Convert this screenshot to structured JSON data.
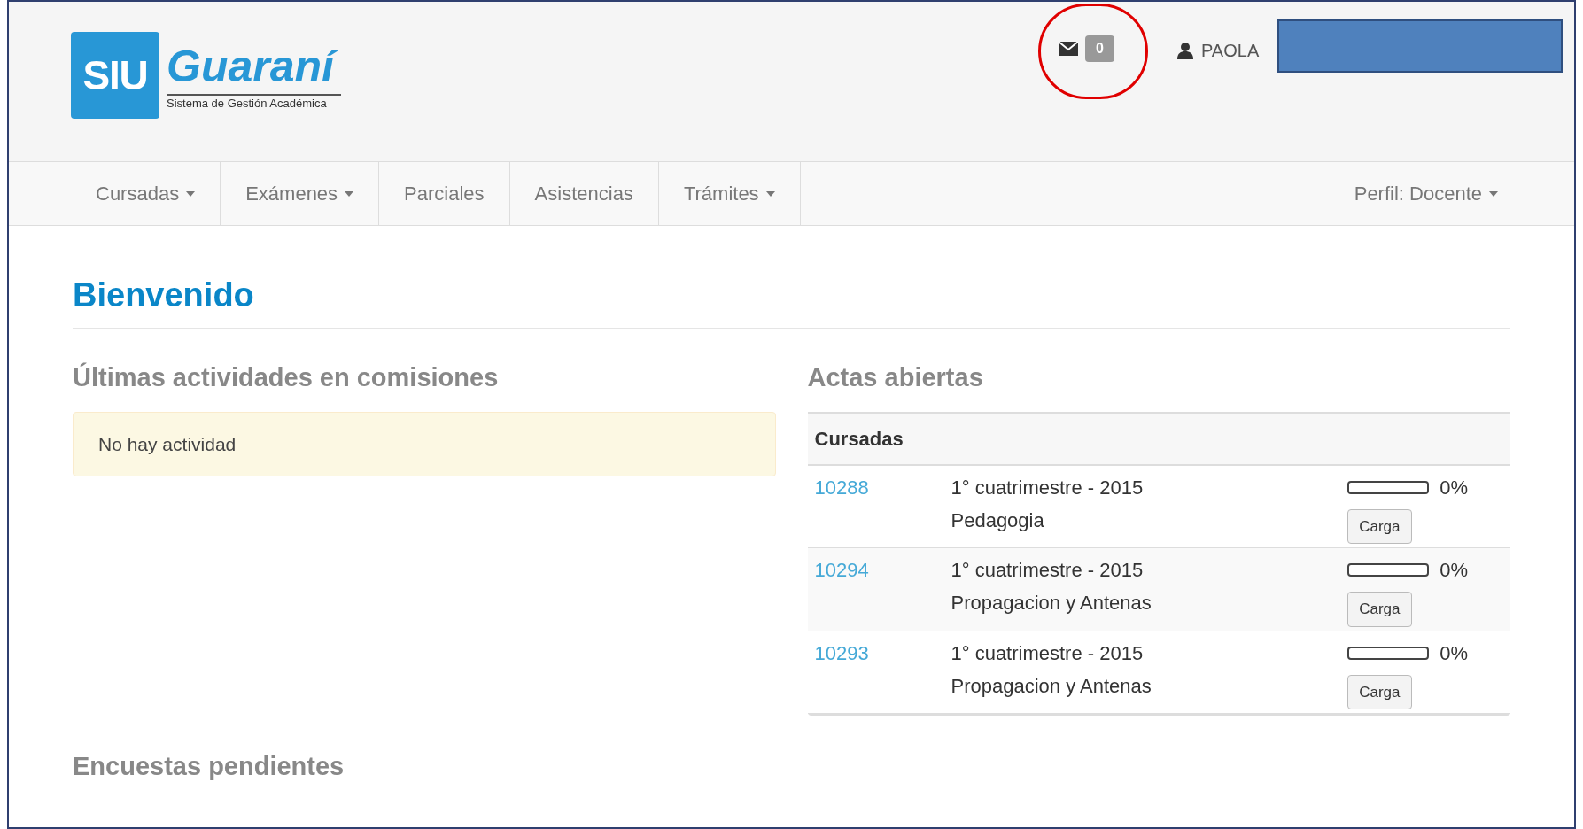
{
  "header": {
    "logo": {
      "mark": "SIU",
      "name": "Guaraní",
      "subtitle": "Sistema de Gestión Académica"
    },
    "messages": {
      "count": "0"
    },
    "user": {
      "name": "PAOLA"
    }
  },
  "nav": {
    "items": [
      {
        "label": "Cursadas",
        "dropdown": true
      },
      {
        "label": "Exámenes",
        "dropdown": true
      },
      {
        "label": "Parciales",
        "dropdown": false
      },
      {
        "label": "Asistencias",
        "dropdown": false
      },
      {
        "label": "Trámites",
        "dropdown": true
      }
    ],
    "profile": {
      "label": "Perfil: Docente",
      "dropdown": true
    }
  },
  "page_title": "Bienvenido",
  "activities": {
    "title": "Últimas actividades en comisiones",
    "alert": "No hay actividad"
  },
  "actas": {
    "title": "Actas abiertas",
    "table": {
      "heading": "Cursadas",
      "rows": [
        {
          "code": "10288",
          "period": "1° cuatrimestre - 2015",
          "subject": "Pedagogia",
          "level": 0,
          "percent": "0%",
          "button": "Carga"
        },
        {
          "code": "10294",
          "period": "1° cuatrimestre - 2015",
          "subject": "Propagacion y Antenas",
          "level": 0,
          "percent": "0%",
          "button": "Carga"
        },
        {
          "code": "10293",
          "period": "1° cuatrimestre - 2015",
          "subject": "Propagacion y Antenas",
          "level": 0,
          "percent": "0%",
          "button": "Carga"
        }
      ]
    }
  },
  "surveys": {
    "title": "Encuestas pendientes"
  }
}
